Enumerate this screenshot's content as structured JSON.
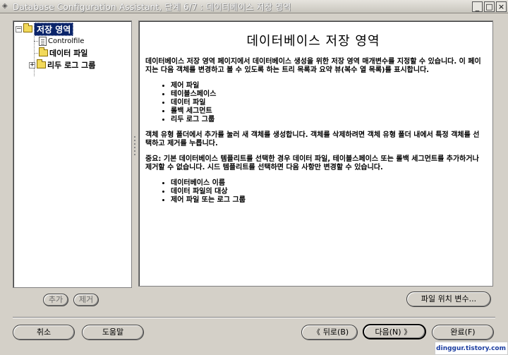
{
  "window": {
    "title": "Database Configuration Assistant, 단계 6/7 : 데이터베이스 저장 영역",
    "buttons": {
      "minimize": "_",
      "maximize": "□",
      "close": "×"
    }
  },
  "tree": {
    "root": "저장 영역",
    "items": [
      {
        "label": "Controlfile"
      },
      {
        "label": "데이터 파일"
      },
      {
        "label": "리두 로그 그룹"
      }
    ]
  },
  "content": {
    "title": "데이터베이스 저장 영역",
    "intro": "데이터베이스 저장 영역 페이지에서 데이터베이스 생성을 위한 저장 영역 매개변수를 지정할 수 있습니다. 이 페이지는 다음 객체를 변경하고 볼 수 있도록 하는 트리 목록과 요약 뷰(복수 열 목록)를 표시합니다.",
    "list1": [
      "제어 파일",
      "테이블스페이스",
      "데이터 파일",
      "롤백 세그먼트",
      "리두 로그 그룹"
    ],
    "para2": "객체 유형 폴더에서 추가를 눌러 새 객체를 생성합니다. 객체를 삭제하려면 객체 유형 폴더 내에서 특정 객체를 선택하고 제거를 누릅니다.",
    "para3": "중요: 기본 데이터베이스 템플리트를 선택한 경우 데이터 파일, 테이블스페이스 또는 롤백 세그먼트를 추가하거나 제거할 수 없습니다. 시드 템플리트를 선택하면 다음 사항만 변경할 수 있습니다.",
    "list2": [
      "데이터베이스 이름",
      "데이터 파일의 대상",
      "제어 파일 또는 로그 그룹"
    ]
  },
  "tree_buttons": {
    "add": "추가",
    "remove": "제거"
  },
  "file_location_button": "파일 위치 변수...",
  "footer": {
    "cancel": "취소",
    "help": "도움말",
    "back": "뒤로(B)",
    "next": "다음(N)",
    "finish": "완료(F)"
  },
  "watermark": "dinggur.tistory.com"
}
